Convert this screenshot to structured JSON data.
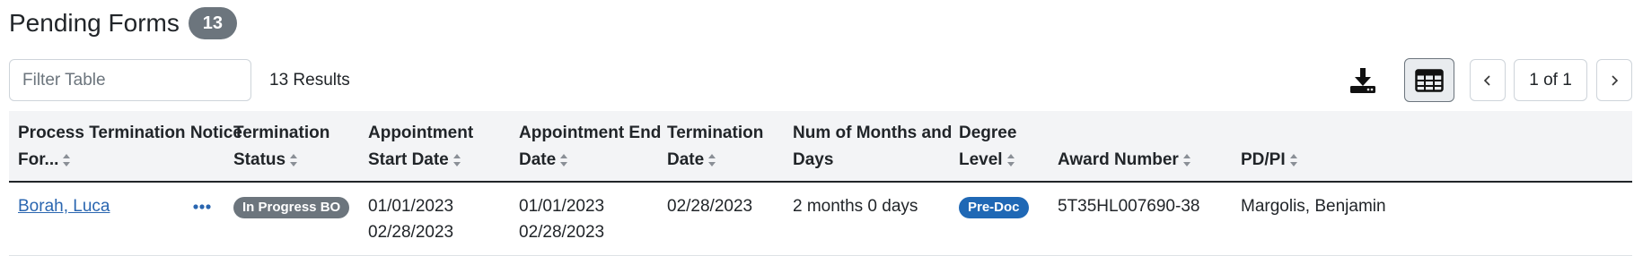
{
  "header": {
    "title": "Pending Forms",
    "count": "13"
  },
  "toolbar": {
    "filter_placeholder": "Filter Table",
    "results": "13 Results",
    "download_icon": "download-icon",
    "table_view_icon": "table-icon",
    "prev_icon": "chevron-left-icon",
    "next_icon": "chevron-right-icon",
    "page_info": "1 of 1"
  },
  "table": {
    "columns": [
      [
        "Process Termination Notice",
        "For..."
      ],
      [
        "Termination",
        "Status"
      ],
      [
        "Appointment",
        "Start Date"
      ],
      [
        "Appointment End",
        "Date"
      ],
      [
        "Termination",
        "Date"
      ],
      [
        "Num of Months and",
        "Days"
      ],
      [
        "Degree",
        "Level"
      ],
      [
        "Award Number"
      ],
      [
        "PD/PI"
      ]
    ],
    "rows": [
      {
        "name": "Borah, Luca",
        "status": "In Progress BO",
        "start_date": [
          "01/01/2023",
          "02/28/2023"
        ],
        "end_date": [
          "01/01/2023",
          "02/28/2023"
        ],
        "termination_date": "02/28/2023",
        "months_days": "2 months 0 days",
        "degree_level": "Pre-Doc",
        "award_number": "5T35HL007690-38",
        "pd_pi": "Margolis, Benjamin"
      }
    ]
  },
  "colors": {
    "status_badge": "#6c757d",
    "degree_badge": "#1f68b5",
    "link": "#2a66b0",
    "header_bg": "#f3f4f6"
  }
}
